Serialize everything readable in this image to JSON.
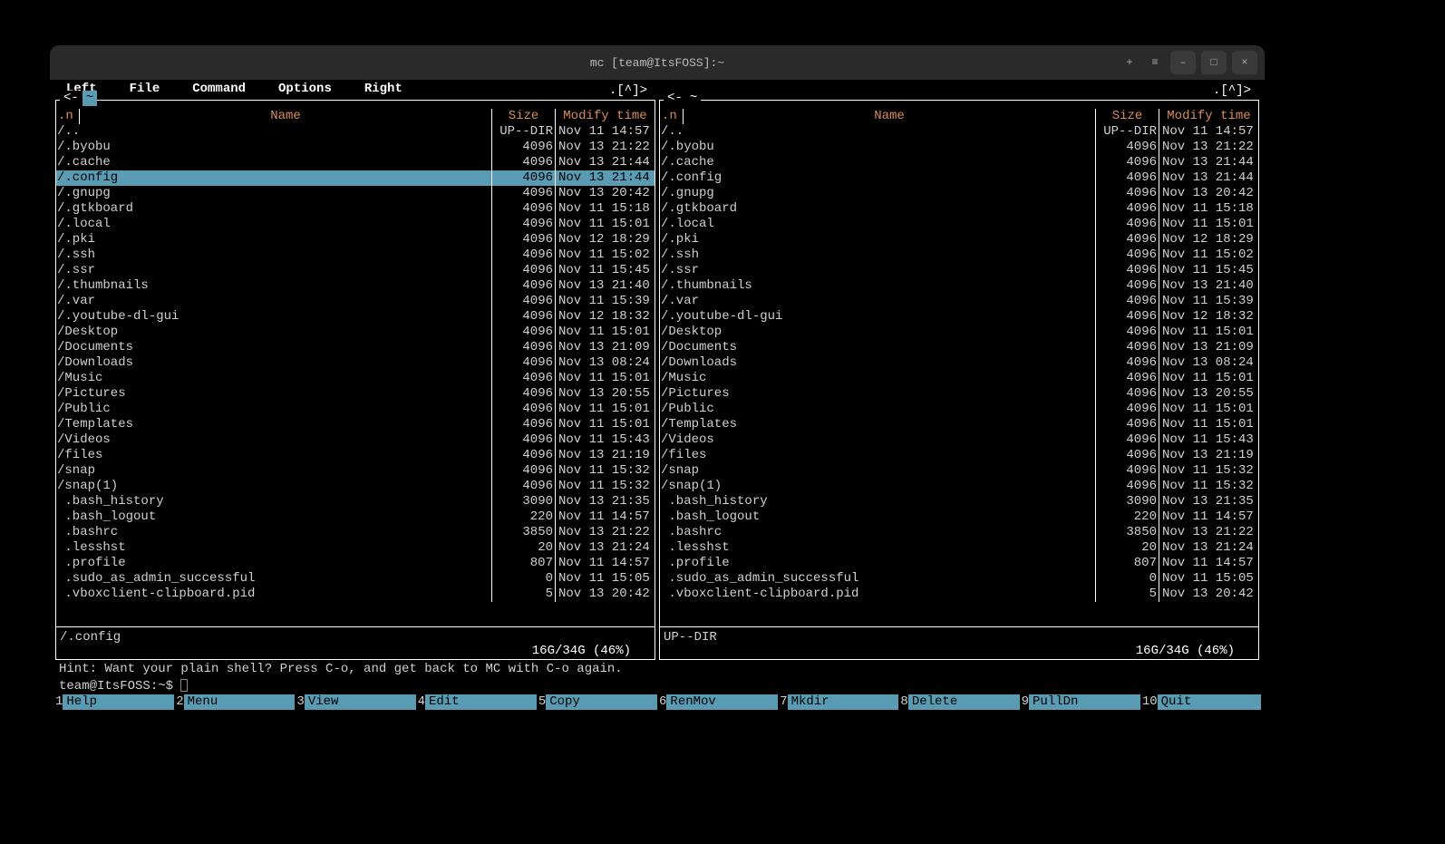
{
  "window": {
    "title": "mc [team@ItsFOSS]:~"
  },
  "menubar": [
    "Left",
    "File",
    "Command",
    "Options",
    "Right"
  ],
  "panels": {
    "left": {
      "path_prefix": "<-",
      "path": " ~ ",
      "updown": ".[^]>",
      "nhdr": ".n",
      "headers": {
        "name": "Name",
        "size": "Size",
        "time": "Modify time"
      },
      "rows": [
        {
          "name": "/..",
          "size": "UP--DIR",
          "time": "Nov 11 14:57",
          "sel": false
        },
        {
          "name": "/.byobu",
          "size": "4096",
          "time": "Nov 13 21:22",
          "sel": false
        },
        {
          "name": "/.cache",
          "size": "4096",
          "time": "Nov 13 21:44",
          "sel": false
        },
        {
          "name": "/.config",
          "size": "4096",
          "time": "Nov 13 21:44",
          "sel": true
        },
        {
          "name": "/.gnupg",
          "size": "4096",
          "time": "Nov 13 20:42",
          "sel": false
        },
        {
          "name": "/.gtkboard",
          "size": "4096",
          "time": "Nov 11 15:18",
          "sel": false
        },
        {
          "name": "/.local",
          "size": "4096",
          "time": "Nov 11 15:01",
          "sel": false
        },
        {
          "name": "/.pki",
          "size": "4096",
          "time": "Nov 12 18:29",
          "sel": false
        },
        {
          "name": "/.ssh",
          "size": "4096",
          "time": "Nov 11 15:02",
          "sel": false
        },
        {
          "name": "/.ssr",
          "size": "4096",
          "time": "Nov 11 15:45",
          "sel": false
        },
        {
          "name": "/.thumbnails",
          "size": "4096",
          "time": "Nov 13 21:40",
          "sel": false
        },
        {
          "name": "/.var",
          "size": "4096",
          "time": "Nov 11 15:39",
          "sel": false
        },
        {
          "name": "/.youtube-dl-gui",
          "size": "4096",
          "time": "Nov 12 18:32",
          "sel": false
        },
        {
          "name": "/Desktop",
          "size": "4096",
          "time": "Nov 11 15:01",
          "sel": false
        },
        {
          "name": "/Documents",
          "size": "4096",
          "time": "Nov 13 21:09",
          "sel": false
        },
        {
          "name": "/Downloads",
          "size": "4096",
          "time": "Nov 13 08:24",
          "sel": false
        },
        {
          "name": "/Music",
          "size": "4096",
          "time": "Nov 11 15:01",
          "sel": false
        },
        {
          "name": "/Pictures",
          "size": "4096",
          "time": "Nov 13 20:55",
          "sel": false
        },
        {
          "name": "/Public",
          "size": "4096",
          "time": "Nov 11 15:01",
          "sel": false
        },
        {
          "name": "/Templates",
          "size": "4096",
          "time": "Nov 11 15:01",
          "sel": false
        },
        {
          "name": "/Videos",
          "size": "4096",
          "time": "Nov 11 15:43",
          "sel": false
        },
        {
          "name": "/files",
          "size": "4096",
          "time": "Nov 13 21:19",
          "sel": false
        },
        {
          "name": "/snap",
          "size": "4096",
          "time": "Nov 11 15:32",
          "sel": false
        },
        {
          "name": "/snap(1)",
          "size": "4096",
          "time": "Nov 11 15:32",
          "sel": false
        },
        {
          "name": " .bash_history",
          "size": "3090",
          "time": "Nov 13 21:35",
          "sel": false
        },
        {
          "name": " .bash_logout",
          "size": "220",
          "time": "Nov 11 14:57",
          "sel": false
        },
        {
          "name": " .bashrc",
          "size": "3850",
          "time": "Nov 13 21:22",
          "sel": false
        },
        {
          "name": " .lesshst",
          "size": "20",
          "time": "Nov 13 21:24",
          "sel": false
        },
        {
          "name": " .profile",
          "size": "807",
          "time": "Nov 11 14:57",
          "sel": false
        },
        {
          "name": " .sudo_as_admin_successful",
          "size": "0",
          "time": "Nov 11 15:05",
          "sel": false
        },
        {
          "name": " .vboxclient-clipboard.pid",
          "size": "5",
          "time": "Nov 13 20:42",
          "sel": false
        }
      ],
      "status": "/.config",
      "disk": "16G/34G (46%)"
    },
    "right": {
      "path_prefix": "<-",
      "path": " ~ ",
      "updown": ".[^]>",
      "nhdr": ".n",
      "headers": {
        "name": "Name",
        "size": "Size",
        "time": "Modify time"
      },
      "rows": [
        {
          "name": "/..",
          "size": "UP--DIR",
          "time": "Nov 11 14:57",
          "sel": false
        },
        {
          "name": "/.byobu",
          "size": "4096",
          "time": "Nov 13 21:22",
          "sel": false
        },
        {
          "name": "/.cache",
          "size": "4096",
          "time": "Nov 13 21:44",
          "sel": false
        },
        {
          "name": "/.config",
          "size": "4096",
          "time": "Nov 13 21:44",
          "sel": false
        },
        {
          "name": "/.gnupg",
          "size": "4096",
          "time": "Nov 13 20:42",
          "sel": false
        },
        {
          "name": "/.gtkboard",
          "size": "4096",
          "time": "Nov 11 15:18",
          "sel": false
        },
        {
          "name": "/.local",
          "size": "4096",
          "time": "Nov 11 15:01",
          "sel": false
        },
        {
          "name": "/.pki",
          "size": "4096",
          "time": "Nov 12 18:29",
          "sel": false
        },
        {
          "name": "/.ssh",
          "size": "4096",
          "time": "Nov 11 15:02",
          "sel": false
        },
        {
          "name": "/.ssr",
          "size": "4096",
          "time": "Nov 11 15:45",
          "sel": false
        },
        {
          "name": "/.thumbnails",
          "size": "4096",
          "time": "Nov 13 21:40",
          "sel": false
        },
        {
          "name": "/.var",
          "size": "4096",
          "time": "Nov 11 15:39",
          "sel": false
        },
        {
          "name": "/.youtube-dl-gui",
          "size": "4096",
          "time": "Nov 12 18:32",
          "sel": false
        },
        {
          "name": "/Desktop",
          "size": "4096",
          "time": "Nov 11 15:01",
          "sel": false
        },
        {
          "name": "/Documents",
          "size": "4096",
          "time": "Nov 13 21:09",
          "sel": false
        },
        {
          "name": "/Downloads",
          "size": "4096",
          "time": "Nov 13 08:24",
          "sel": false
        },
        {
          "name": "/Music",
          "size": "4096",
          "time": "Nov 11 15:01",
          "sel": false
        },
        {
          "name": "/Pictures",
          "size": "4096",
          "time": "Nov 13 20:55",
          "sel": false
        },
        {
          "name": "/Public",
          "size": "4096",
          "time": "Nov 11 15:01",
          "sel": false
        },
        {
          "name": "/Templates",
          "size": "4096",
          "time": "Nov 11 15:01",
          "sel": false
        },
        {
          "name": "/Videos",
          "size": "4096",
          "time": "Nov 11 15:43",
          "sel": false
        },
        {
          "name": "/files",
          "size": "4096",
          "time": "Nov 13 21:19",
          "sel": false
        },
        {
          "name": "/snap",
          "size": "4096",
          "time": "Nov 11 15:32",
          "sel": false
        },
        {
          "name": "/snap(1)",
          "size": "4096",
          "time": "Nov 11 15:32",
          "sel": false
        },
        {
          "name": " .bash_history",
          "size": "3090",
          "time": "Nov 13 21:35",
          "sel": false
        },
        {
          "name": " .bash_logout",
          "size": "220",
          "time": "Nov 11 14:57",
          "sel": false
        },
        {
          "name": " .bashrc",
          "size": "3850",
          "time": "Nov 13 21:22",
          "sel": false
        },
        {
          "name": " .lesshst",
          "size": "20",
          "time": "Nov 13 21:24",
          "sel": false
        },
        {
          "name": " .profile",
          "size": "807",
          "time": "Nov 11 14:57",
          "sel": false
        },
        {
          "name": " .sudo_as_admin_successful",
          "size": "0",
          "time": "Nov 11 15:05",
          "sel": false
        },
        {
          "name": " .vboxclient-clipboard.pid",
          "size": "5",
          "time": "Nov 13 20:42",
          "sel": false
        }
      ],
      "status": "UP--DIR",
      "disk": "16G/34G (46%)"
    }
  },
  "hint": "Hint: Want your plain shell? Press C-o, and get back to MC with C-o again.",
  "prompt": "team@ItsFOSS:~$ ",
  "fnkeys": [
    {
      "n": "1",
      "label": "Help"
    },
    {
      "n": "2",
      "label": "Menu"
    },
    {
      "n": "3",
      "label": "View"
    },
    {
      "n": "4",
      "label": "Edit"
    },
    {
      "n": "5",
      "label": "Copy"
    },
    {
      "n": "6",
      "label": "RenMov"
    },
    {
      "n": "7",
      "label": "Mkdir"
    },
    {
      "n": "8",
      "label": "Delete"
    },
    {
      "n": "9",
      "label": "PullDn"
    },
    {
      "n": "10",
      "label": "Quit"
    }
  ]
}
